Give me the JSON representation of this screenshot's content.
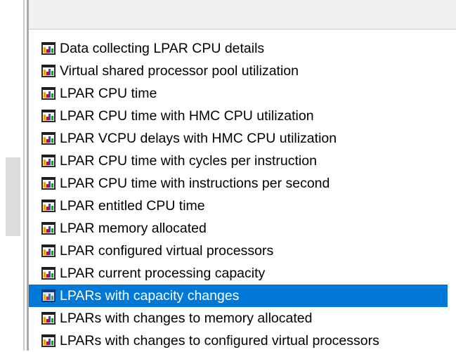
{
  "list": {
    "items": [
      {
        "label": "Data collecting LPAR CPU details",
        "icon": "bar-chart-icon",
        "selected": false
      },
      {
        "label": "Virtual shared processor pool utilization",
        "icon": "bar-chart-icon",
        "selected": false
      },
      {
        "label": "LPAR CPU time",
        "icon": "bar-chart-icon",
        "selected": false
      },
      {
        "label": "LPAR CPU time with HMC CPU utilization",
        "icon": "bar-chart-icon",
        "selected": false
      },
      {
        "label": "LPAR VCPU delays with HMC CPU utilization",
        "icon": "bar-chart-icon",
        "selected": false
      },
      {
        "label": "LPAR CPU time with cycles per instruction",
        "icon": "bar-chart-icon",
        "selected": false
      },
      {
        "label": "LPAR CPU time with instructions per second",
        "icon": "bar-chart-icon",
        "selected": false
      },
      {
        "label": "LPAR entitled CPU time",
        "icon": "bar-chart-icon",
        "selected": false
      },
      {
        "label": "LPAR memory allocated",
        "icon": "bar-chart-icon",
        "selected": false
      },
      {
        "label": "LPAR configured virtual processors",
        "icon": "bar-chart-icon",
        "selected": false
      },
      {
        "label": "LPAR current processing capacity",
        "icon": "bar-chart-icon",
        "selected": false
      },
      {
        "label": "LPARs with capacity changes",
        "icon": "bar-chart-icon",
        "selected": true
      },
      {
        "label": "LPARs with changes to memory allocated",
        "icon": "bar-chart-icon",
        "selected": false
      },
      {
        "label": "LPARs with changes to configured virtual processors",
        "icon": "bar-chart-icon",
        "selected": false
      }
    ]
  },
  "colors": {
    "selection": "#0078d7",
    "header": "#f0f0f0"
  }
}
